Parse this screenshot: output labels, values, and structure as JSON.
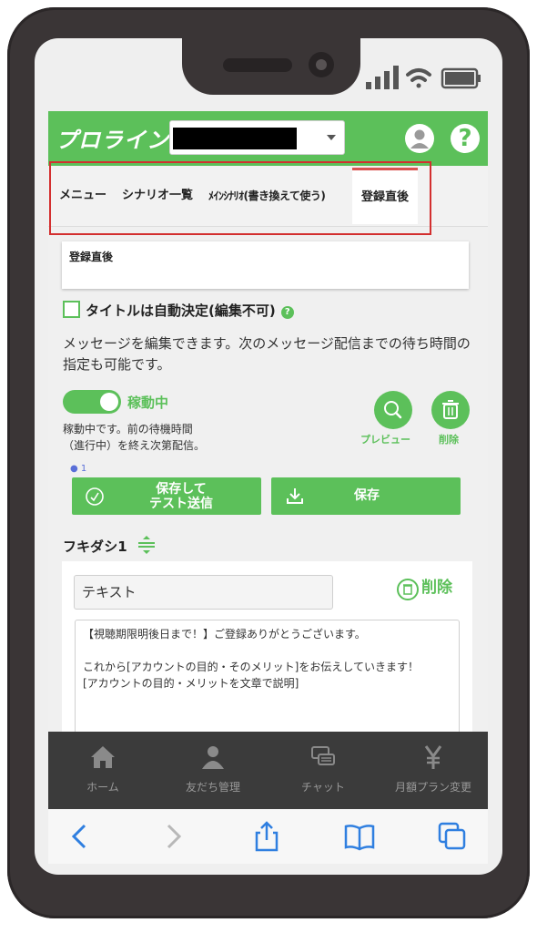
{
  "header": {
    "logo": "プロライン",
    "account_redacted": true
  },
  "tabs": [
    {
      "label": "メニュー"
    },
    {
      "label": "シナリオ一覧"
    },
    {
      "label": "ﾒｲﾝｼﾅﾘｵ(書き換えて使う)"
    },
    {
      "label": "登録直後",
      "active": true
    }
  ],
  "title_field": {
    "value": "登録直後"
  },
  "auto_title": {
    "label": "タイトルは自動決定(編集不可)",
    "checked": false
  },
  "description": "メッセージを編集できます。次のメッセージ配信までの待ち時間の指定も可能です。",
  "status": {
    "toggle_label": "稼動中",
    "toggle_on": true,
    "note_line1": "稼動中です。前の待機時間",
    "note_line2": "（進行中）を終え次第配信。"
  },
  "actions": {
    "preview_label": "プレビュー",
    "delete_label": "削除",
    "user_count": "1",
    "save_test_line1": "保存して",
    "save_test_line2": "テスト送信",
    "save_label": "保存"
  },
  "bubble": {
    "title": "フキダシ1",
    "type_value": "テキスト",
    "delete_label": "削除",
    "message_lines": [
      "【視聴期限明後日まで！】ご登録ありがとうございます。",
      "",
      "これから[アカウントの目的・そのメリット]をお伝えしていきます！",
      "[アカウントの目的・メリットを文章で説明]"
    ]
  },
  "bottom_nav": [
    {
      "label": "ホーム",
      "icon": "home-icon"
    },
    {
      "label": "友だち管理",
      "icon": "users-icon"
    },
    {
      "label": "チャット",
      "icon": "chat-icon"
    },
    {
      "label": "月額プラン変更",
      "icon": "yen-icon"
    }
  ],
  "colors": {
    "accent": "#5cc05a",
    "highlight": "#d32f2f",
    "phone": "#3a3536",
    "nav": "#3b3b3b"
  }
}
